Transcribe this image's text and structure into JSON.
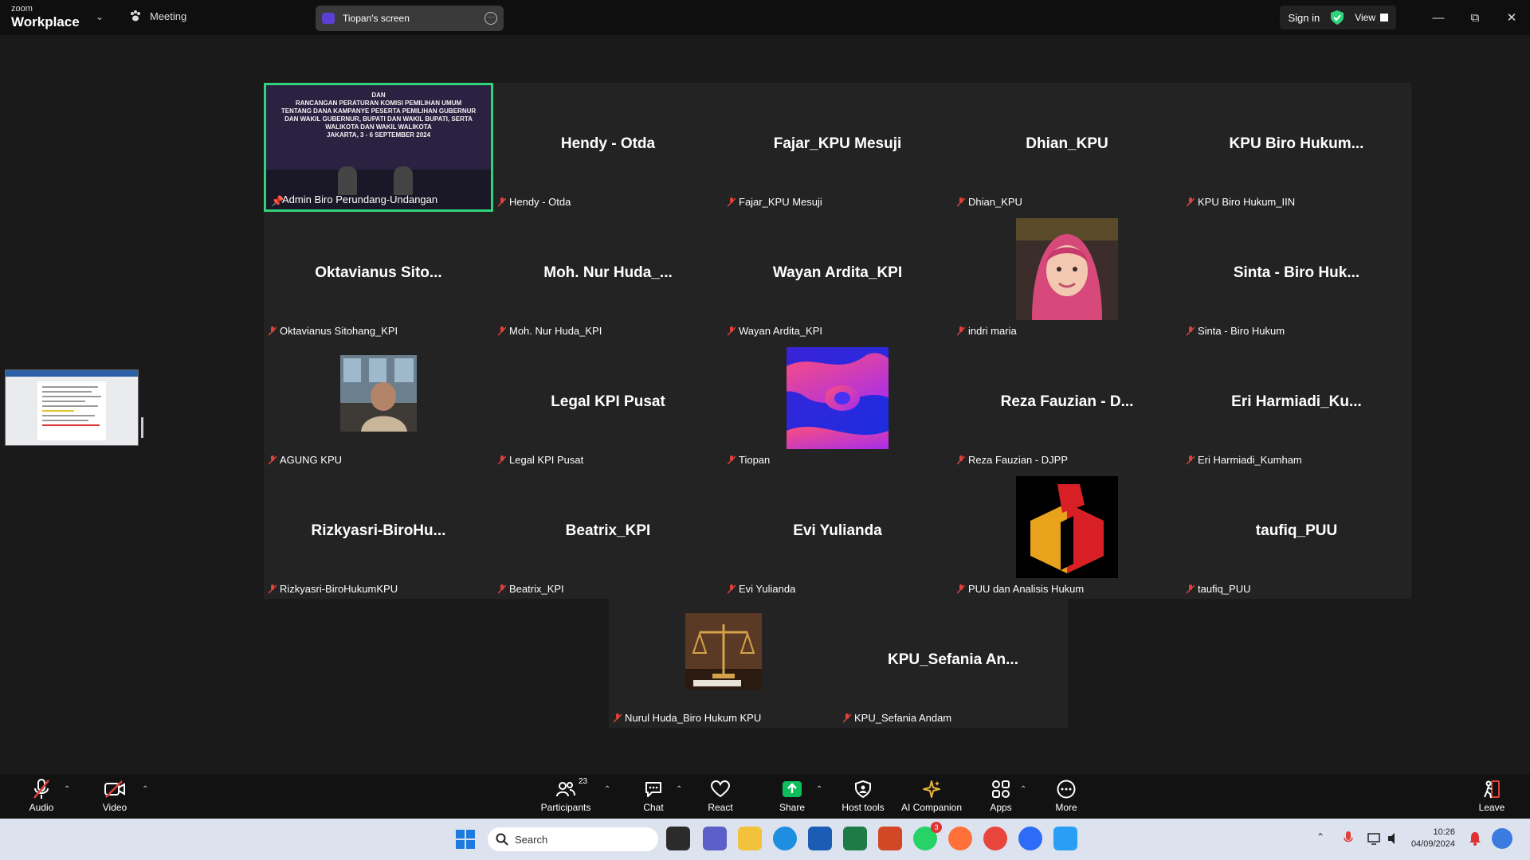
{
  "titlebar": {
    "brand_small": "zoom",
    "brand_name": "Workplace",
    "meeting_label": "Meeting",
    "screen_share_label": "Tiopan's screen",
    "sign_in_label": "Sign in",
    "view_label": "View",
    "colors": {
      "bar": "#0f0f0f",
      "secure_green": "#2fd37a"
    }
  },
  "gallery": {
    "tiles": [
      {
        "display_name": "",
        "label": "Admin Biro Perundang-Undangan",
        "type": "video-slide",
        "active": true
      },
      {
        "display_name": "Hendy - Otda",
        "label": "Hendy - Otda",
        "type": "name"
      },
      {
        "display_name": "Fajar_KPU Mesuji",
        "label": "Fajar_KPU Mesuji",
        "type": "name"
      },
      {
        "display_name": "Dhian_KPU",
        "label": "Dhian_KPU",
        "type": "name"
      },
      {
        "display_name": "KPU Biro Hukum...",
        "label": "KPU Biro Hukum_IIN",
        "type": "name"
      },
      {
        "display_name": "Oktavianus Sito...",
        "label": "Oktavianus Sitohang_KPI",
        "type": "name"
      },
      {
        "display_name": "Moh. Nur Huda_...",
        "label": "Moh. Nur Huda_KPI",
        "type": "name"
      },
      {
        "display_name": "Wayan Ardita_KPI",
        "label": "Wayan Ardita_KPI",
        "type": "name"
      },
      {
        "display_name": "",
        "label": "indri maria",
        "type": "photo-woman"
      },
      {
        "display_name": "Sinta - Biro Huk...",
        "label": "Sinta - Biro Hukum",
        "type": "name"
      },
      {
        "display_name": "",
        "label": "AGUNG KPU",
        "type": "photo-office"
      },
      {
        "display_name": "Legal KPI Pusat",
        "label": "Legal KPI Pusat",
        "type": "name"
      },
      {
        "display_name": "",
        "label": "Tiopan",
        "type": "photo-abstract"
      },
      {
        "display_name": "Reza Fauzian - D...",
        "label": "Reza Fauzian - DJPP",
        "type": "name"
      },
      {
        "display_name": "Eri Harmiadi_Ku...",
        "label": "Eri Harmiadi_Kumham",
        "type": "name"
      },
      {
        "display_name": "Rizkyasri-BiroHu...",
        "label": "Rizkyasri-BiroHukumKPU",
        "type": "name"
      },
      {
        "display_name": "Beatrix_KPI",
        "label": "Beatrix_KPI",
        "type": "name"
      },
      {
        "display_name": "Evi Yulianda",
        "label": "Evi Yulianda",
        "type": "name"
      },
      {
        "display_name": "",
        "label": "PUU dan Analisis Hukum",
        "type": "logo"
      },
      {
        "display_name": "taufiq_PUU",
        "label": "taufiq_PUU",
        "type": "name"
      }
    ],
    "bottom_tiles": [
      {
        "display_name": "",
        "label": "Nurul Huda_Biro Hukum KPU",
        "type": "photo-scales"
      },
      {
        "display_name": "KPU_Sefania An...",
        "label": "KPU_Sefania Andam",
        "type": "name"
      }
    ],
    "slide_text": "DAN\nRANCANGAN PERATURAN KOMISI PEMILIHAN UMUM\nTENTANG DANA KAMPANYE PESERTA PEMILIHAN GUBERNUR\nDAN WAKIL GUBERNUR, BUPATI DAN WAKIL BUPATI, SERTA\nWALIKOTA DAN WAKIL WALIKOTA\nJAKARTA, 3 - 6 SEPTEMBER 2024"
  },
  "controls": {
    "audio": "Audio",
    "video": "Video",
    "participants": "Participants",
    "participants_count": "23",
    "chat": "Chat",
    "react": "React",
    "share": "Share",
    "host_tools": "Host tools",
    "ai_companion": "AI Companion",
    "apps": "Apps",
    "more": "More",
    "leave": "Leave",
    "colors": {
      "share_green": "#0dbf5a",
      "muted_red": "#e0413b",
      "ai_gold": "#e9b23b"
    }
  },
  "taskbar": {
    "search_placeholder": "Search",
    "time": "10:26",
    "date": "04/09/2024",
    "whatsapp_badge": "3"
  }
}
